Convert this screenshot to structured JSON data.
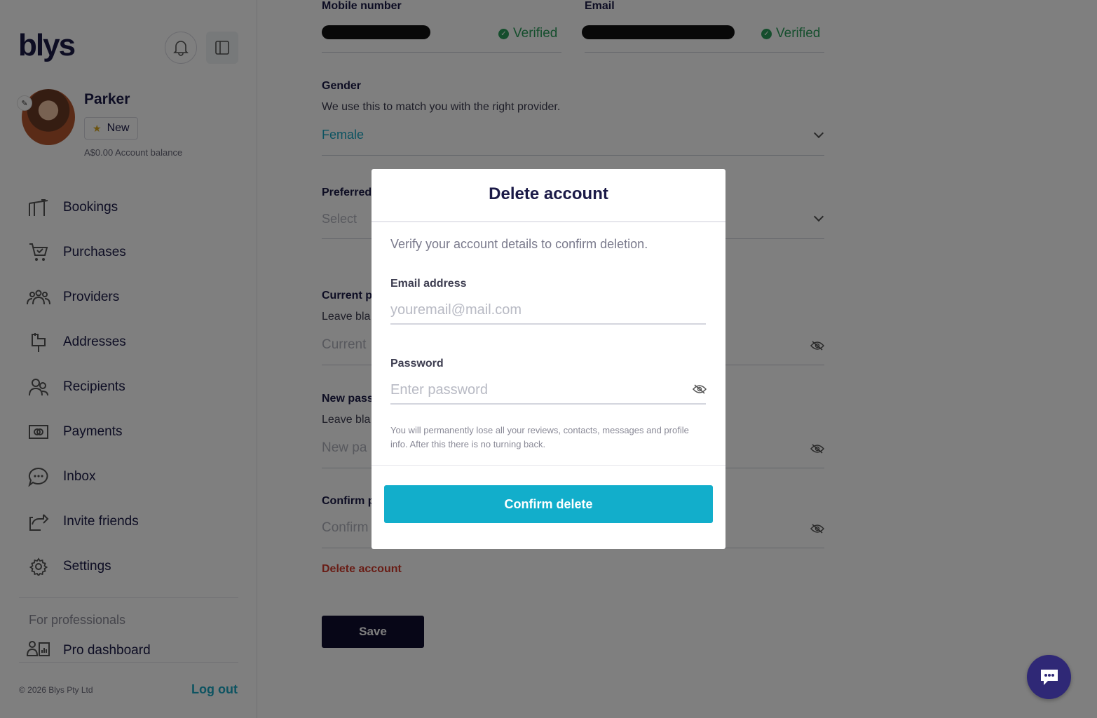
{
  "sidebar": {
    "logo": "blys",
    "user": {
      "name": "Parker",
      "badge": "New",
      "balance": "A$0.00 Account balance"
    },
    "nav": [
      {
        "label": "Bookings",
        "icon": "bookings-icon"
      },
      {
        "label": "Purchases",
        "icon": "cart-icon"
      },
      {
        "label": "Providers",
        "icon": "providers-icon"
      },
      {
        "label": "Addresses",
        "icon": "mailbox-icon"
      },
      {
        "label": "Recipients",
        "icon": "recipients-icon"
      },
      {
        "label": "Payments",
        "icon": "payments-icon"
      },
      {
        "label": "Inbox",
        "icon": "chat-bubble-icon"
      },
      {
        "label": "Invite friends",
        "icon": "share-icon"
      },
      {
        "label": "Settings",
        "icon": "gear-icon"
      }
    ],
    "for_professionals": "For professionals",
    "pro_dashboard": "Pro dashboard",
    "copyright": "© 2026 Blys Pty Ltd",
    "logout": "Log out"
  },
  "main": {
    "mobile_label": "Mobile number",
    "email_label": "Email",
    "verified": "Verified",
    "gender_label": "Gender",
    "gender_help": "We use this to match you with the right provider.",
    "gender_value": "Female",
    "preferred_label": "Preferred",
    "preferred_value": "Select",
    "current_label": "Current p",
    "current_help": "Leave bla",
    "current_placeholder": "Current",
    "new_label": "New pass",
    "new_help": "Leave bla",
    "new_placeholder": "New pa",
    "confirm_label": "Confirm p",
    "confirm_placeholder": "Confirm",
    "delete_account": "Delete account",
    "save": "Save"
  },
  "modal": {
    "title": "Delete account",
    "description": "Verify your account details to confirm deletion.",
    "email_label": "Email address",
    "email_placeholder": "youremail@mail.com",
    "password_label": "Password",
    "password_placeholder": "Enter password",
    "note": "You will permanently lose all your reviews, contacts, messages and profile info. After this there is no turning back.",
    "confirm_button": "Confirm delete"
  },
  "colors": {
    "brand_dark": "#1b1a47",
    "accent": "#12aecb",
    "verified": "#2a9d5a",
    "danger": "#d33a2c"
  }
}
